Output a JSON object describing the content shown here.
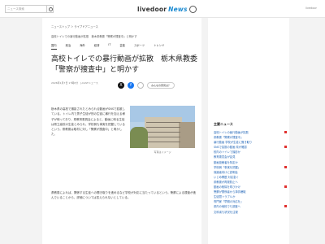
{
  "header": {
    "search_placeholder": "ニュース検索",
    "logo_text": "livedoor",
    "logo_accent": "News",
    "right_link": "livedoor"
  },
  "article": {
    "breadcrumb": "ニューストップ ＞ ライブドアニュース",
    "subtitle": "高校トイレでの暴行動画が拡散　栃木県教委「警察が捜査中」と明かす",
    "tags": [
      "国内",
      "政治",
      "海外",
      "経済",
      "IT",
      "芸能",
      "スポーツ",
      "トレンド"
    ],
    "active_tag_index": 0,
    "title": "高校トイレでの暴行動画が拡散　栃木県教委「警察が捜査中」と明かす",
    "meta": "2026年1月7日 17時0分　J-CASTニュース",
    "share": {
      "x_label": "X",
      "fb_label": "f",
      "line_label": "L",
      "comment_label": "みんなの意見は？"
    },
    "para1": "栃木県の高校で撮影されたとみられる動画がSNSで拡散している。トイレ内で男子生徒が別の生徒に暴行を加える様子が映っており、県教育委員会によると、動画に映る生徒は県立高校の生徒とみられ、学校側も事実を把握しているという。県教委は取材に対し「警察が捜査中」と明かした。",
    "photo_caption": "写真はイメージ",
    "para2": "県教委によれば、関係する生徒への聞き取りを進めるなど学校が対応に当たっているという。警察による捜査が進んでいることから、詳細については答えられないとしている。"
  },
  "sidebar": {
    "title": "主要ニュース",
    "items": [
      {
        "text": "高校トイレの暴行動画が拡散",
        "badge": true
      },
      {
        "text": "県教委「警察が捜査中」",
        "badge": false
      },
      {
        "text": "暴行動画 学校が生徒に聞き取り",
        "badge": false
      },
      {
        "text": "SNSで拡散の動画 県が確認",
        "badge": true
      },
      {
        "text": "校内のトイレで撮影か",
        "badge": false
      },
      {
        "text": "教育委員会が会見",
        "badge": false
      },
      {
        "text": "動画投稿者を特定か",
        "badge": false
      },
      {
        "text": "学校側「事実を把握」",
        "badge": true
      },
      {
        "text": "保護者向けに説明会",
        "badge": false
      },
      {
        "text": "いじめ問題 対応急ぐ",
        "badge": false
      },
      {
        "text": "県教委が再発防止へ",
        "badge": false
      },
      {
        "text": "動画の削除を呼びかけ",
        "badge": true
      },
      {
        "text": "警察が関係者から事情聴取",
        "badge": false
      },
      {
        "text": "生徒間トラブルか",
        "badge": false
      },
      {
        "text": "専門家「早期の対応を」",
        "badge": false
      },
      {
        "text": "県内の他校でも調査へ",
        "badge": true
      },
      {
        "text": "文科省も状況を注視",
        "badge": false
      }
    ]
  }
}
